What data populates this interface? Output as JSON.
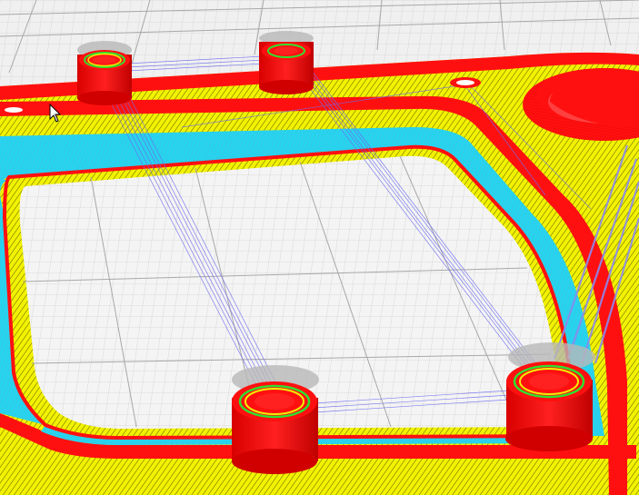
{
  "viewport": {
    "type": "3d-slicer-layer-preview",
    "colors": {
      "bed_background": "#f0f0f0",
      "bed_grid_minor": "#d0d0d0",
      "bed_grid_major": "#a8a8a8",
      "perimeter": "#ff1010",
      "perimeter_dark": "#c80000",
      "infill": "#f2f200",
      "infill_hatch": "#4a4a00",
      "skirt": "#20d8f0",
      "travel": "#4040e0",
      "travel_light": "#8a8af0",
      "support_ghost": "#b8b8b8",
      "inner_ring_green": "#30e030",
      "inner_ring_yellow": "#f0f000"
    },
    "bosses": [
      {
        "name": "boss-top-left"
      },
      {
        "name": "boss-top-middle"
      },
      {
        "name": "boss-bottom-left"
      },
      {
        "name": "boss-bottom-right"
      },
      {
        "name": "boss-large-top-right"
      }
    ],
    "cursor": "mouse-pointer-icon"
  }
}
